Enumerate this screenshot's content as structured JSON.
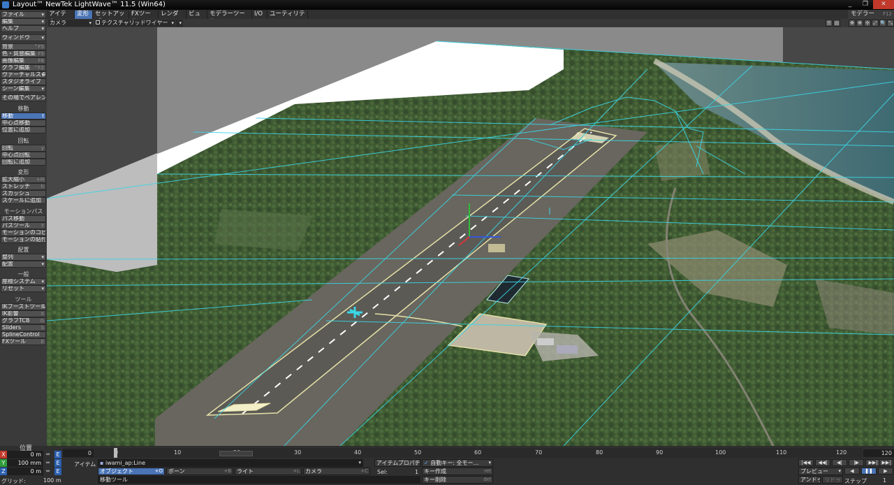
{
  "title": "Layout™ NewTek LightWave™ 11.5 (Win64)",
  "window_buttons": [
    "_",
    "❐",
    "✕"
  ],
  "tabs": [
    "アイテム",
    "変形",
    "セットアップ",
    "FXツール",
    "レンダー",
    "ビュー",
    "モデラーツール",
    "I/O",
    "ユーティリティ"
  ],
  "active_tab": "変形",
  "modeler": {
    "label": "モデラー",
    "shortcut": "F12"
  },
  "left": {
    "file": "ファイル",
    "edit": "編集",
    "help": "ヘルプ",
    "window": "ウィンドウ",
    "bg": {
      "label": "背景",
      "sc": "^F5"
    },
    "surface": {
      "label": "色・質感編集",
      "sc": "F5"
    },
    "image": {
      "label": "画像編集",
      "sc": "F6"
    },
    "graph": {
      "label": "グラフ編集",
      "sc": "^F2"
    },
    "virtual": {
      "label": "ヴァーチャルスタジオ",
      "sc": "▾"
    },
    "studio": {
      "label": "スタジオライブ"
    },
    "scene": {
      "label": "シーン編集",
      "sc": "▾"
    },
    "inplace": {
      "label": "その場でペアレント"
    },
    "h_move": "移動",
    "move": {
      "label": "移動",
      "sc": "t"
    },
    "pivot": {
      "label": "中心点移動"
    },
    "addpos": {
      "label": "位置に追加"
    },
    "h_rotate": "回転",
    "rotate": {
      "label": "回転",
      "sc": "y"
    },
    "pivotrot": {
      "label": "中心点回転"
    },
    "addrot": {
      "label": "回転に追加"
    },
    "h_deform": "変形",
    "size": {
      "label": "拡大縮小",
      "sc": "+H"
    },
    "stretch": {
      "label": "ストレッチ",
      "sc": "h"
    },
    "squash": {
      "label": "スカッシュ"
    },
    "addscale": {
      "label": "スケールに追加"
    },
    "h_path": "モーションパス",
    "pathmove": {
      "label": "パス移動"
    },
    "pathtool": {
      "label": "パスツール",
      "sc": "Y"
    },
    "copymotion": {
      "label": "モーションのコピー"
    },
    "pastemotion": {
      "label": "モーションの貼付け"
    },
    "h_layout": "配置",
    "align": {
      "label": "整列",
      "sc": "▾"
    },
    "arrange": {
      "label": "配置",
      "sc": "▾"
    },
    "h_general": "一般",
    "coordsys": {
      "label": "座標システム",
      "sc": "▾"
    },
    "reset": {
      "label": "リセット",
      "sc": "▾"
    },
    "h_tools": "ツール",
    "ikscale": {
      "label": "IKブーストツール",
      "sc": "B"
    },
    "ikspline": {
      "label": "IK影響",
      "sc": "X"
    },
    "graphtcb": {
      "label": "グラフTCB",
      "sc": "G"
    },
    "sliders": {
      "label": "Sliders",
      "sc": "S"
    },
    "spline": {
      "label": "SplineControl"
    },
    "fxtool": {
      "label": "FXツール",
      "sc": "E"
    }
  },
  "viewport": {
    "camera": "カメラ",
    "mode": "テクスチャリッドワイヤー",
    "icons": [
      "☰",
      "▤",
      "✥",
      "✥",
      "✣",
      "⤢",
      "🔍",
      "⤡"
    ]
  },
  "position": {
    "label": "位置",
    "x": {
      "axis": "X",
      "value": "0 m"
    },
    "y": {
      "axis": "Y",
      "value": "100 mm"
    },
    "z": {
      "axis": "Z",
      "value": "0 m"
    },
    "grid": {
      "label": "グリッド:",
      "value": "100 m"
    }
  },
  "timeline": {
    "current": "0",
    "end": "120",
    "ticks": [
      "0",
      "10",
      "20",
      "30",
      "40",
      "50",
      "60",
      "70",
      "80",
      "90",
      "100",
      "110",
      "120"
    ]
  },
  "item": {
    "label": "アイテム",
    "current": "iwami_ap:Line",
    "props": {
      "label": "アイテムプロパティ",
      "sc": "p"
    },
    "sel_label": "Sel:",
    "sel_value": "1"
  },
  "objects": {
    "label": "オブジェクト",
    "sc": "+O"
  },
  "bones": {
    "label": "ボーン",
    "sc": "+B"
  },
  "lights": {
    "label": "ライト",
    "sc": "+L"
  },
  "cameras": {
    "label": "カメラ",
    "sc": "+C"
  },
  "autokey": {
    "check": "✓",
    "label": "自動キー: 全モー…"
  },
  "createkey": {
    "label": "キー作成",
    "sc": "ret"
  },
  "deletekey": {
    "label": "キー削除",
    "sc": "del"
  },
  "status": "移動ツール",
  "playback": {
    "buttons_row1": [
      "|◀◀",
      "◀◀|",
      "◀|",
      "|▶",
      "▶▶|",
      "▶▶|"
    ],
    "preview": "プレビュー",
    "step_label": "ステップ",
    "step_value": "1",
    "autokey_btn": "アンドゥ",
    "redo_btn": "リドゥ"
  }
}
